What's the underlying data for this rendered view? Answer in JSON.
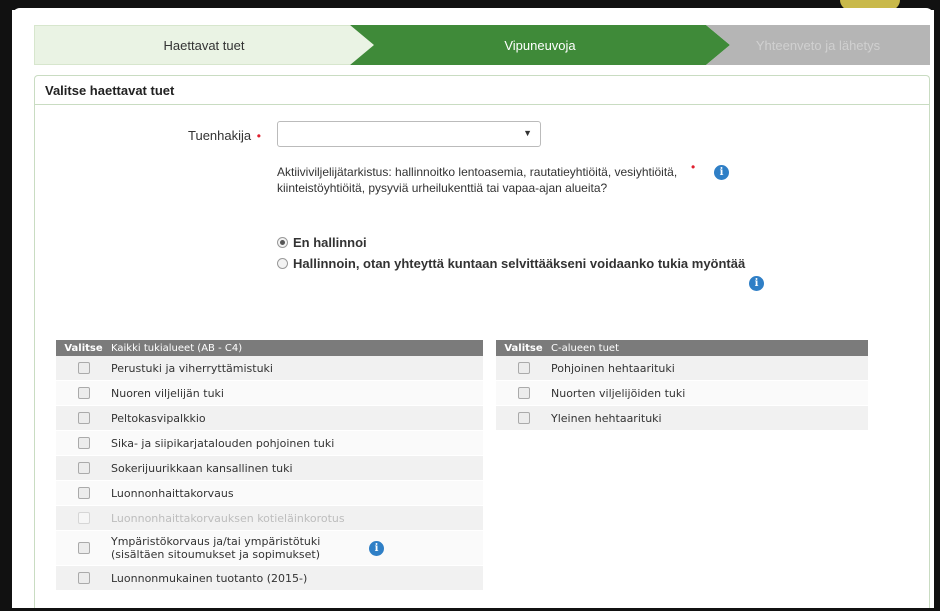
{
  "wizard": {
    "steps": [
      {
        "label": "Haettavat tuet",
        "state": "visited"
      },
      {
        "label": "Vipuneuvoja",
        "state": "active"
      },
      {
        "label": "Yhteenveto ja lähetys",
        "state": "disabled"
      }
    ]
  },
  "panel": {
    "title": "Valitse haettavat tuet"
  },
  "form": {
    "applicant_label": "Tuenhakija",
    "required_mark": "•",
    "applicant_value": "",
    "question": "Aktiiviviljelijätarkistus: hallinnoitko lentoasemia, rautatieyhtiöitä, vesiyhtiöitä, kiinteistöyhtiöitä, pysyviä urheilukenttiä tai vapaa-ajan alueita?",
    "options": [
      {
        "label": "En hallinnoi",
        "checked": true
      },
      {
        "label": "Hallinnoin, otan yhteyttä kuntaan selvittääkseni voidaanko tukia myöntää",
        "checked": false
      }
    ]
  },
  "table_left": {
    "select_header": "Valitse",
    "header": "Kaikki tukialueet (AB - C4)",
    "rows": [
      {
        "label": "Perustuki ja viherryttämistuki",
        "enabled": true
      },
      {
        "label": "Nuoren viljelijän tuki",
        "enabled": true
      },
      {
        "label": "Peltokasvipalkkio",
        "enabled": true
      },
      {
        "label": "Sika- ja siipikarjatalouden pohjoinen tuki",
        "enabled": true
      },
      {
        "label": "Sokerijuurikkaan kansallinen tuki",
        "enabled": true
      },
      {
        "label": "Luonnonhaittakorvaus",
        "enabled": true
      },
      {
        "label": "Luonnonhaittakorvauksen kotieläinkorotus",
        "enabled": false
      },
      {
        "label": "Ympäristökorvaus ja/tai ympäristötuki (sisältäen sitoumukset ja sopimukset)",
        "enabled": true
      },
      {
        "label": "Luonnonmukainen tuotanto (2015-)",
        "enabled": true
      }
    ]
  },
  "table_right": {
    "select_header": "Valitse",
    "header": "C-alueen tuet",
    "rows": [
      {
        "label": "Pohjoinen hehtaarituki",
        "enabled": true
      },
      {
        "label": "Nuorten viljelijöiden tuki",
        "enabled": true
      },
      {
        "label": "Yleinen hehtaarituki",
        "enabled": true
      }
    ]
  },
  "icons": {
    "info": "info-icon",
    "dropdown": "chevron-down-icon"
  },
  "colors": {
    "active_step": "#3f8a39",
    "visited_step": "#eaf3e4",
    "disabled_step": "#b5b5b5",
    "table_header": "#7b7b7b",
    "info": "#2f7fc6",
    "required": "#e0202f"
  }
}
